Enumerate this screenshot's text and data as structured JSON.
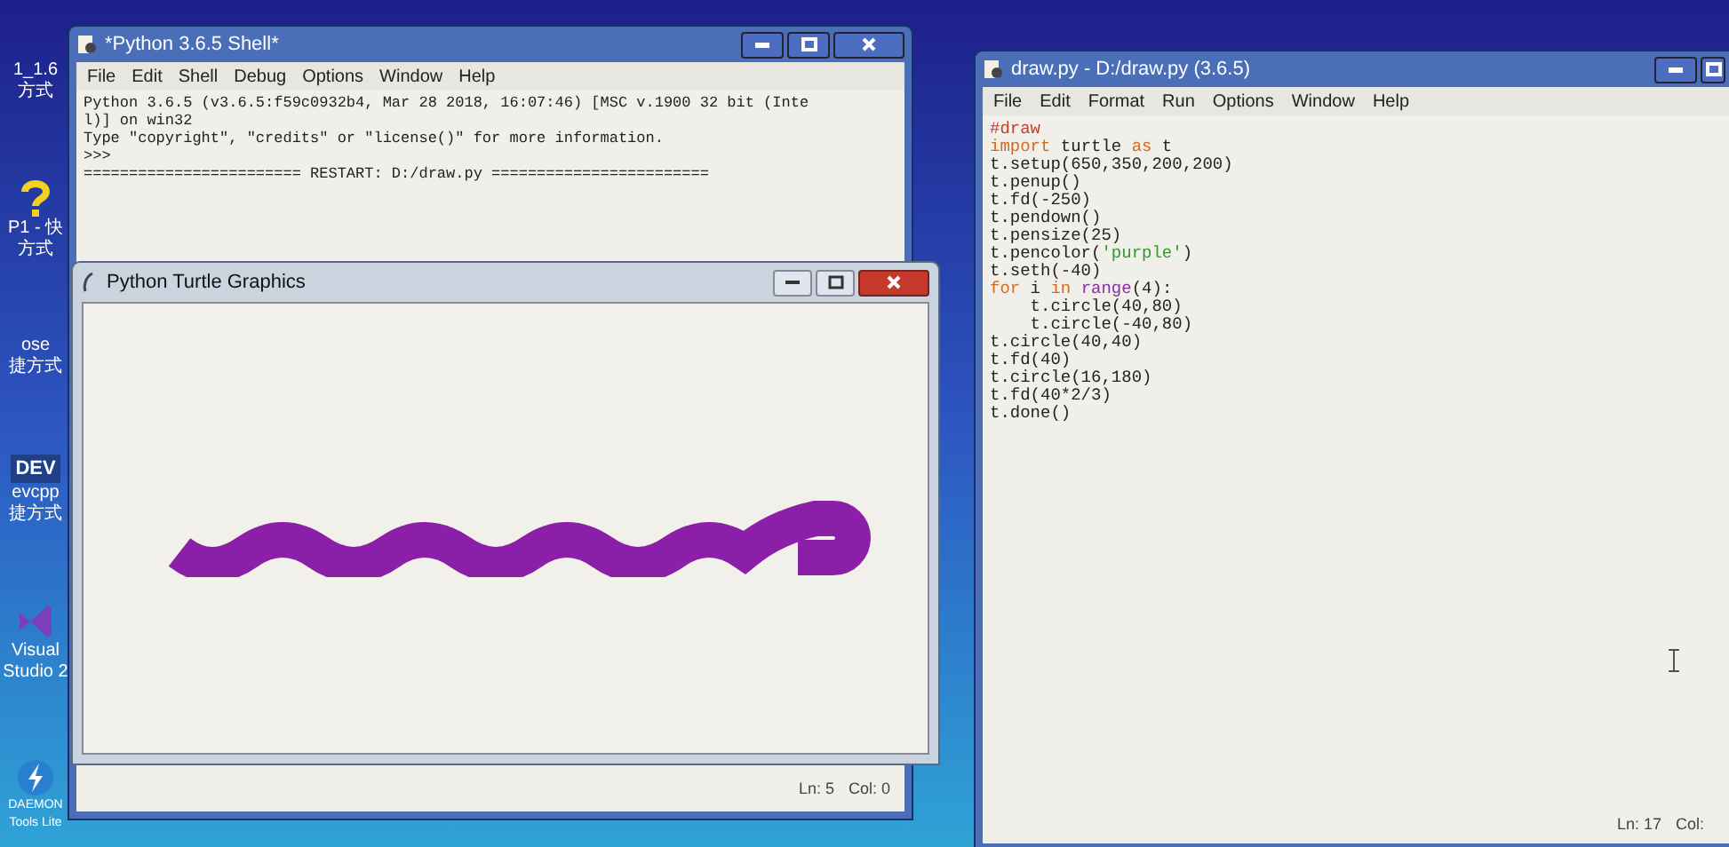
{
  "desktop_icons": [
    {
      "kind": "text",
      "labels": [
        "1_1.6",
        "方式"
      ]
    },
    {
      "kind": "help",
      "labels": [
        "P1 - 快",
        "方式"
      ]
    },
    {
      "kind": "text",
      "labels": [
        "ose",
        "捷方式"
      ]
    },
    {
      "kind": "dev",
      "badge": "DEV",
      "labels": [
        "evcpp",
        "捷方式"
      ]
    },
    {
      "kind": "studio",
      "labels": [
        "Visual",
        "Studio 2"
      ]
    },
    {
      "kind": "daemon",
      "labels": [
        "DAEMON",
        "Tools Lite"
      ]
    }
  ],
  "shell_window": {
    "title": "*Python 3.6.5 Shell*",
    "menu": [
      "File",
      "Edit",
      "Shell",
      "Debug",
      "Options",
      "Window",
      "Help"
    ],
    "lines": [
      "Python 3.6.5 (v3.6.5:f59c0932b4, Mar 28 2018, 16:07:46) [MSC v.1900 32 bit (Inte",
      "l)] on win32",
      "Type \"copyright\", \"credits\" or \"license()\" for more information.",
      ">>> ",
      "======================== RESTART: D:/draw.py ========================"
    ],
    "status": [
      "Ln: 5",
      "Col: 0"
    ]
  },
  "turtle_window": {
    "title": "Python Turtle Graphics"
  },
  "editor_window": {
    "title": "draw.py - D:/draw.py (3.6.5)",
    "menu": [
      "File",
      "Edit",
      "Format",
      "Run",
      "Options",
      "Window",
      "Help"
    ],
    "code": [
      [
        {
          "kind": "comment",
          "text": "#draw"
        }
      ],
      [
        {
          "kind": "keyword",
          "text": "import"
        },
        {
          "kind": "plain",
          "text": " turtle "
        },
        {
          "kind": "keyword",
          "text": "as"
        },
        {
          "kind": "plain",
          "text": " t"
        }
      ],
      [
        {
          "kind": "plain",
          "text": "t.setup(650,350,200,200)"
        }
      ],
      [
        {
          "kind": "plain",
          "text": "t.penup()"
        }
      ],
      [
        {
          "kind": "plain",
          "text": "t.fd(-250)"
        }
      ],
      [
        {
          "kind": "plain",
          "text": "t.pendown()"
        }
      ],
      [
        {
          "kind": "plain",
          "text": "t.pensize(25)"
        }
      ],
      [
        {
          "kind": "plain",
          "text": "t.pencolor("
        },
        {
          "kind": "string",
          "text": "'purple'"
        },
        {
          "kind": "plain",
          "text": ")"
        }
      ],
      [
        {
          "kind": "plain",
          "text": "t.seth(-40)"
        }
      ],
      [
        {
          "kind": "keyword",
          "text": "for"
        },
        {
          "kind": "plain",
          "text": " i "
        },
        {
          "kind": "keyword",
          "text": "in"
        },
        {
          "kind": "builtin",
          "text": " range"
        },
        {
          "kind": "plain",
          "text": "(4):"
        }
      ],
      [
        {
          "kind": "plain",
          "text": "    t.circle(40,80)"
        }
      ],
      [
        {
          "kind": "plain",
          "text": "    t.circle(-40,80)"
        }
      ],
      [
        {
          "kind": "plain",
          "text": "t.circle(40,40)"
        }
      ],
      [
        {
          "kind": "plain",
          "text": "t.fd(40)"
        }
      ],
      [
        {
          "kind": "plain",
          "text": "t.circle(16,180)"
        }
      ],
      [
        {
          "kind": "plain",
          "text": "t.fd(40*2/3)"
        }
      ],
      [
        {
          "kind": "plain",
          "text": "t.done()"
        }
      ]
    ],
    "status": [
      "Ln: 17",
      "Col:"
    ]
  }
}
